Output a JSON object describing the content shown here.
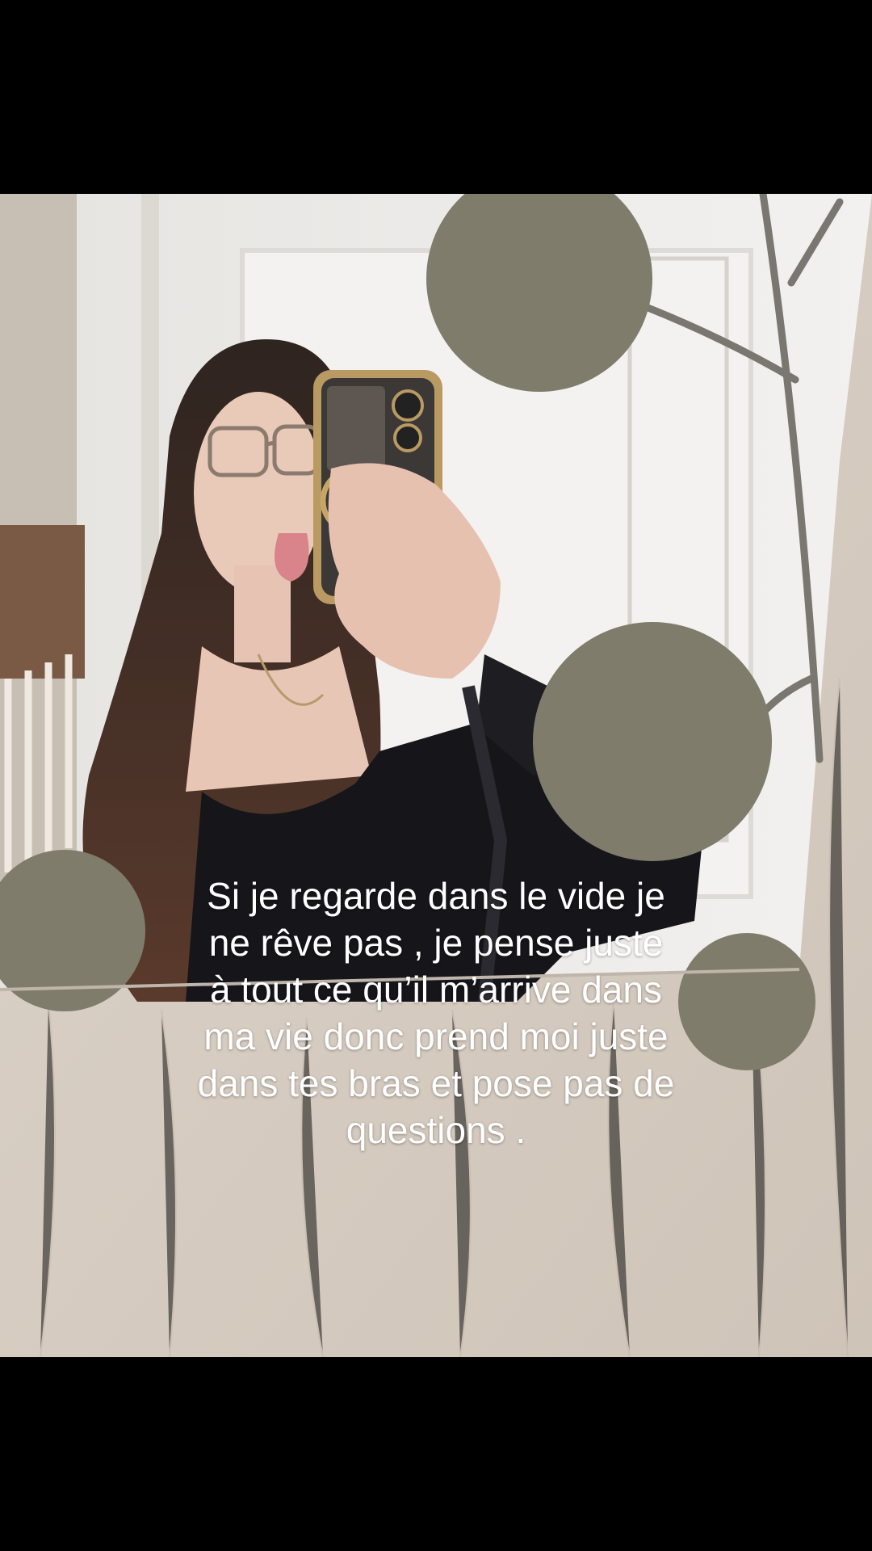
{
  "caption": {
    "text": "Si je regarde dans le vide je\nne rêve pas , je pense juste\nà tout ce qu’il m’arrive dans\nma vie donc prend moi juste\ndans tes bras et pose pas de\nquestions ."
  },
  "colors": {
    "letterbox": "#000000",
    "wall": "#d8cfc5",
    "mirror_wall": "#ecebea",
    "mirror_dot": "#7f7c6b",
    "caption_text": "#ffffff"
  }
}
